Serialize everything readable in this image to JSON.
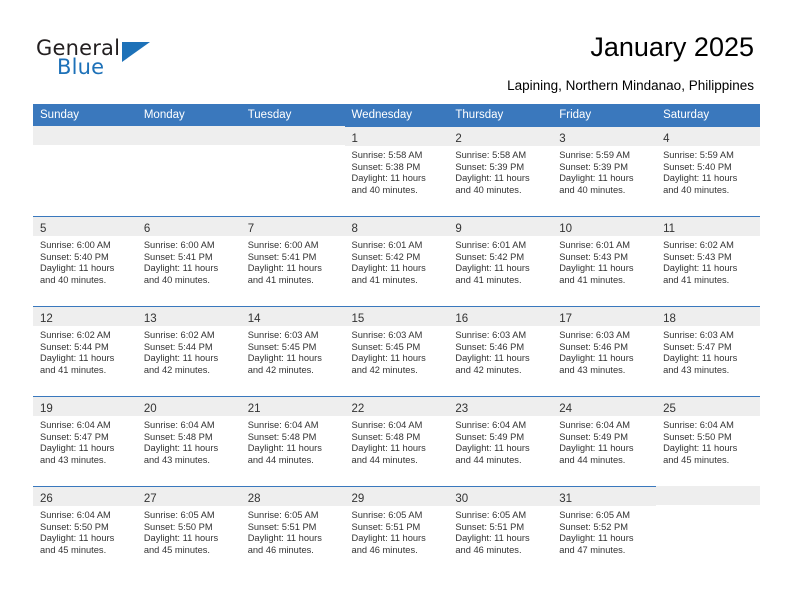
{
  "brand": {
    "name_part1": "General",
    "name_part2": "Blue",
    "accent_color": "#1d71b8",
    "logo_icon": "triangle-flag-icon"
  },
  "header": {
    "title": "January 2025",
    "subtitle": "Lapining, Northern Mindanao, Philippines"
  },
  "calendar": {
    "header_color": "#3a78bd",
    "weekday_headers": [
      "Sunday",
      "Monday",
      "Tuesday",
      "Wednesday",
      "Thursday",
      "Friday",
      "Saturday"
    ],
    "weeks": [
      [
        {
          "day": "",
          "empty": true
        },
        {
          "day": "",
          "empty": true
        },
        {
          "day": "",
          "empty": true
        },
        {
          "day": "1",
          "sunrise": "Sunrise: 5:58 AM",
          "sunset": "Sunset: 5:38 PM",
          "daylight_line1": "Daylight: 11 hours",
          "daylight_line2": "and 40 minutes."
        },
        {
          "day": "2",
          "sunrise": "Sunrise: 5:58 AM",
          "sunset": "Sunset: 5:39 PM",
          "daylight_line1": "Daylight: 11 hours",
          "daylight_line2": "and 40 minutes."
        },
        {
          "day": "3",
          "sunrise": "Sunrise: 5:59 AM",
          "sunset": "Sunset: 5:39 PM",
          "daylight_line1": "Daylight: 11 hours",
          "daylight_line2": "and 40 minutes."
        },
        {
          "day": "4",
          "sunrise": "Sunrise: 5:59 AM",
          "sunset": "Sunset: 5:40 PM",
          "daylight_line1": "Daylight: 11 hours",
          "daylight_line2": "and 40 minutes."
        }
      ],
      [
        {
          "day": "5",
          "sunrise": "Sunrise: 6:00 AM",
          "sunset": "Sunset: 5:40 PM",
          "daylight_line1": "Daylight: 11 hours",
          "daylight_line2": "and 40 minutes."
        },
        {
          "day": "6",
          "sunrise": "Sunrise: 6:00 AM",
          "sunset": "Sunset: 5:41 PM",
          "daylight_line1": "Daylight: 11 hours",
          "daylight_line2": "and 40 minutes."
        },
        {
          "day": "7",
          "sunrise": "Sunrise: 6:00 AM",
          "sunset": "Sunset: 5:41 PM",
          "daylight_line1": "Daylight: 11 hours",
          "daylight_line2": "and 41 minutes."
        },
        {
          "day": "8",
          "sunrise": "Sunrise: 6:01 AM",
          "sunset": "Sunset: 5:42 PM",
          "daylight_line1": "Daylight: 11 hours",
          "daylight_line2": "and 41 minutes."
        },
        {
          "day": "9",
          "sunrise": "Sunrise: 6:01 AM",
          "sunset": "Sunset: 5:42 PM",
          "daylight_line1": "Daylight: 11 hours",
          "daylight_line2": "and 41 minutes."
        },
        {
          "day": "10",
          "sunrise": "Sunrise: 6:01 AM",
          "sunset": "Sunset: 5:43 PM",
          "daylight_line1": "Daylight: 11 hours",
          "daylight_line2": "and 41 minutes."
        },
        {
          "day": "11",
          "sunrise": "Sunrise: 6:02 AM",
          "sunset": "Sunset: 5:43 PM",
          "daylight_line1": "Daylight: 11 hours",
          "daylight_line2": "and 41 minutes."
        }
      ],
      [
        {
          "day": "12",
          "sunrise": "Sunrise: 6:02 AM",
          "sunset": "Sunset: 5:44 PM",
          "daylight_line1": "Daylight: 11 hours",
          "daylight_line2": "and 41 minutes."
        },
        {
          "day": "13",
          "sunrise": "Sunrise: 6:02 AM",
          "sunset": "Sunset: 5:44 PM",
          "daylight_line1": "Daylight: 11 hours",
          "daylight_line2": "and 42 minutes."
        },
        {
          "day": "14",
          "sunrise": "Sunrise: 6:03 AM",
          "sunset": "Sunset: 5:45 PM",
          "daylight_line1": "Daylight: 11 hours",
          "daylight_line2": "and 42 minutes."
        },
        {
          "day": "15",
          "sunrise": "Sunrise: 6:03 AM",
          "sunset": "Sunset: 5:45 PM",
          "daylight_line1": "Daylight: 11 hours",
          "daylight_line2": "and 42 minutes."
        },
        {
          "day": "16",
          "sunrise": "Sunrise: 6:03 AM",
          "sunset": "Sunset: 5:46 PM",
          "daylight_line1": "Daylight: 11 hours",
          "daylight_line2": "and 42 minutes."
        },
        {
          "day": "17",
          "sunrise": "Sunrise: 6:03 AM",
          "sunset": "Sunset: 5:46 PM",
          "daylight_line1": "Daylight: 11 hours",
          "daylight_line2": "and 43 minutes."
        },
        {
          "day": "18",
          "sunrise": "Sunrise: 6:03 AM",
          "sunset": "Sunset: 5:47 PM",
          "daylight_line1": "Daylight: 11 hours",
          "daylight_line2": "and 43 minutes."
        }
      ],
      [
        {
          "day": "19",
          "sunrise": "Sunrise: 6:04 AM",
          "sunset": "Sunset: 5:47 PM",
          "daylight_line1": "Daylight: 11 hours",
          "daylight_line2": "and 43 minutes."
        },
        {
          "day": "20",
          "sunrise": "Sunrise: 6:04 AM",
          "sunset": "Sunset: 5:48 PM",
          "daylight_line1": "Daylight: 11 hours",
          "daylight_line2": "and 43 minutes."
        },
        {
          "day": "21",
          "sunrise": "Sunrise: 6:04 AM",
          "sunset": "Sunset: 5:48 PM",
          "daylight_line1": "Daylight: 11 hours",
          "daylight_line2": "and 44 minutes."
        },
        {
          "day": "22",
          "sunrise": "Sunrise: 6:04 AM",
          "sunset": "Sunset: 5:48 PM",
          "daylight_line1": "Daylight: 11 hours",
          "daylight_line2": "and 44 minutes."
        },
        {
          "day": "23",
          "sunrise": "Sunrise: 6:04 AM",
          "sunset": "Sunset: 5:49 PM",
          "daylight_line1": "Daylight: 11 hours",
          "daylight_line2": "and 44 minutes."
        },
        {
          "day": "24",
          "sunrise": "Sunrise: 6:04 AM",
          "sunset": "Sunset: 5:49 PM",
          "daylight_line1": "Daylight: 11 hours",
          "daylight_line2": "and 44 minutes."
        },
        {
          "day": "25",
          "sunrise": "Sunrise: 6:04 AM",
          "sunset": "Sunset: 5:50 PM",
          "daylight_line1": "Daylight: 11 hours",
          "daylight_line2": "and 45 minutes."
        }
      ],
      [
        {
          "day": "26",
          "sunrise": "Sunrise: 6:04 AM",
          "sunset": "Sunset: 5:50 PM",
          "daylight_line1": "Daylight: 11 hours",
          "daylight_line2": "and 45 minutes."
        },
        {
          "day": "27",
          "sunrise": "Sunrise: 6:05 AM",
          "sunset": "Sunset: 5:50 PM",
          "daylight_line1": "Daylight: 11 hours",
          "daylight_line2": "and 45 minutes."
        },
        {
          "day": "28",
          "sunrise": "Sunrise: 6:05 AM",
          "sunset": "Sunset: 5:51 PM",
          "daylight_line1": "Daylight: 11 hours",
          "daylight_line2": "and 46 minutes."
        },
        {
          "day": "29",
          "sunrise": "Sunrise: 6:05 AM",
          "sunset": "Sunset: 5:51 PM",
          "daylight_line1": "Daylight: 11 hours",
          "daylight_line2": "and 46 minutes."
        },
        {
          "day": "30",
          "sunrise": "Sunrise: 6:05 AM",
          "sunset": "Sunset: 5:51 PM",
          "daylight_line1": "Daylight: 11 hours",
          "daylight_line2": "and 46 minutes."
        },
        {
          "day": "31",
          "sunrise": "Sunrise: 6:05 AM",
          "sunset": "Sunset: 5:52 PM",
          "daylight_line1": "Daylight: 11 hours",
          "daylight_line2": "and 47 minutes."
        },
        {
          "day": "",
          "empty": true
        }
      ]
    ]
  }
}
